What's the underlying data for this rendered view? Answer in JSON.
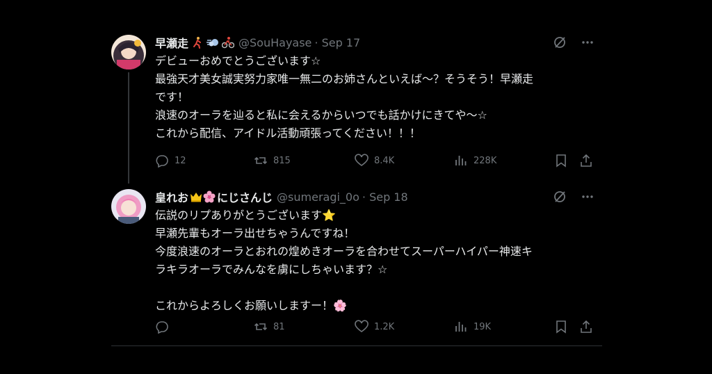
{
  "colors": {
    "background": "#000000",
    "text": "#e7e9ea",
    "muted": "#71767b",
    "divider": "#2f3336"
  },
  "tweets": [
    {
      "name": "早瀬走",
      "name_emojis": [
        "running-person-emoji",
        "dash-emoji",
        "cyclist-emoji"
      ],
      "handle": "@SouHayase",
      "date": "· Sep 17",
      "text": "デビューおめでとうございます☆\n最強天才美女誠実努力家唯一無二のお姉さんといえば〜？そうそう！早瀬走\nです！\n浪速のオーラを辿ると私に会えるからいつでも話かけにきてや〜☆\nこれから配信、アイドル活動頑張ってください！！！",
      "replies": "12",
      "retweets": "815",
      "likes": "8.4K",
      "views": "228K"
    },
    {
      "name": "皇れお",
      "name_emojis": [
        "crown-emoji",
        "cherry-blossom-emoji"
      ],
      "name_suffix": "にじさんじ",
      "handle": "@sumeragi_0o",
      "date": "· Sep 18",
      "text": "伝説のリプありがとうございます⭐\n早瀬先輩もオーラ出せちゃうんですね！\n今度浪速のオーラとおれの煌めきオーラを合わせてスーパーハイパー神速キ\nラキラオーラでみんなを虜にしちゃいます？☆\n\nこれからよろしくお願いしますー！🌸",
      "replies": "",
      "retweets": "81",
      "likes": "1.2K",
      "views": "19K"
    }
  ]
}
